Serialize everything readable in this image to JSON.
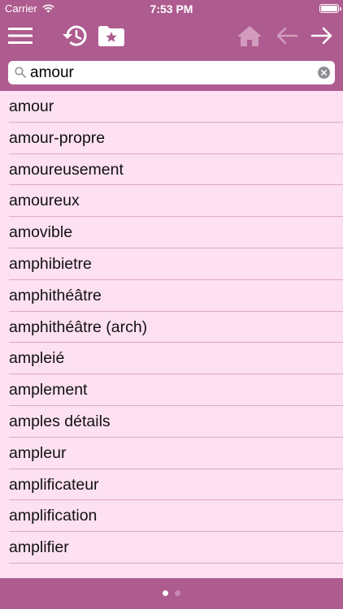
{
  "status": {
    "carrier": "Carrier",
    "time": "7:53 PM"
  },
  "toolbar": {
    "icons": [
      "menu-icon",
      "history-icon",
      "favorites-folder-icon",
      "home-icon",
      "back-arrow-icon",
      "forward-arrow-icon"
    ]
  },
  "search": {
    "value": "amour",
    "placeholder": ""
  },
  "words": [
    "amour",
    "amour-propre",
    "amoureusement",
    "amoureux",
    "amovible",
    "amphibietre",
    "amphithéâtre",
    "amphithéâtre (arch)",
    "ampleié",
    "amplement",
    "amples détails",
    "ampleur",
    "amplificateur",
    "amplification",
    "amplifier"
  ],
  "pager": {
    "pages": 2,
    "current": 1
  },
  "colors": {
    "bar": "#ae5b8f",
    "list_bg": "#fde0f1",
    "separator": "#dca9c7",
    "disabled_icon": "#d39cbe"
  }
}
